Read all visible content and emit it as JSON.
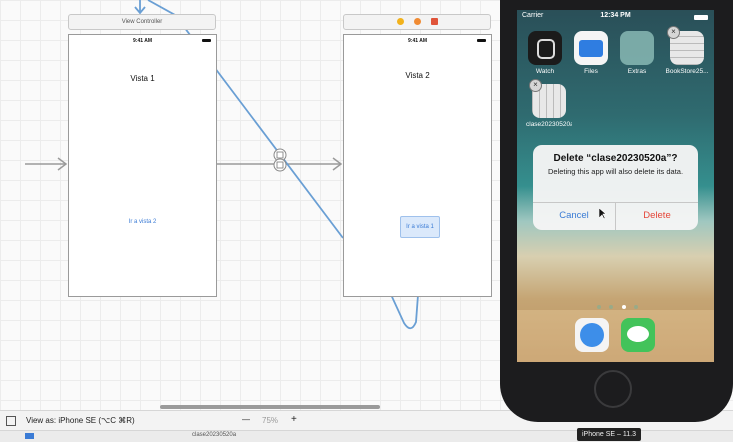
{
  "storyboard": {
    "vc1": {
      "dock_label": "View Controller",
      "time": "9:41 AM",
      "title": "Vista 1",
      "link": "Ir a vista 2"
    },
    "vc2": {
      "time": "9:41 AM",
      "title": "Vista 2",
      "button": "Ir a vista 1"
    }
  },
  "toolbar": {
    "view_as": "View as: iPhone SE (⌥C ⌘R)",
    "zoom_minus": "—",
    "zoom": "75%",
    "zoom_plus": "+",
    "filename": "clase20230520a"
  },
  "simulator": {
    "carrier": "Carrier",
    "time": "12:34 PM",
    "apps": [
      {
        "label": "Watch",
        "icon": "watch-icon",
        "color": "#1b1b1b"
      },
      {
        "label": "Files",
        "icon": "folder-icon",
        "color": "#2f7de1"
      },
      {
        "label": "Extras",
        "icon": "folder-icon",
        "color": "#88b8b4"
      },
      {
        "label": "BookStore25...",
        "icon": "grid-icon",
        "color": "#d8d8d8"
      },
      {
        "label": "clase20230520a",
        "icon": "grid-icon",
        "color": "#d8d8d8"
      }
    ],
    "alert": {
      "title": "Delete “clase20230520a”?",
      "message": "Deleting this app will also delete its data.",
      "cancel": "Cancel",
      "delete": "Delete"
    },
    "device_tag": "iPhone SE – 11.3"
  },
  "colors": {
    "ios_blue": "#3a7bd5",
    "destructive": "#e5463a",
    "segue": "#6a9fd4"
  }
}
